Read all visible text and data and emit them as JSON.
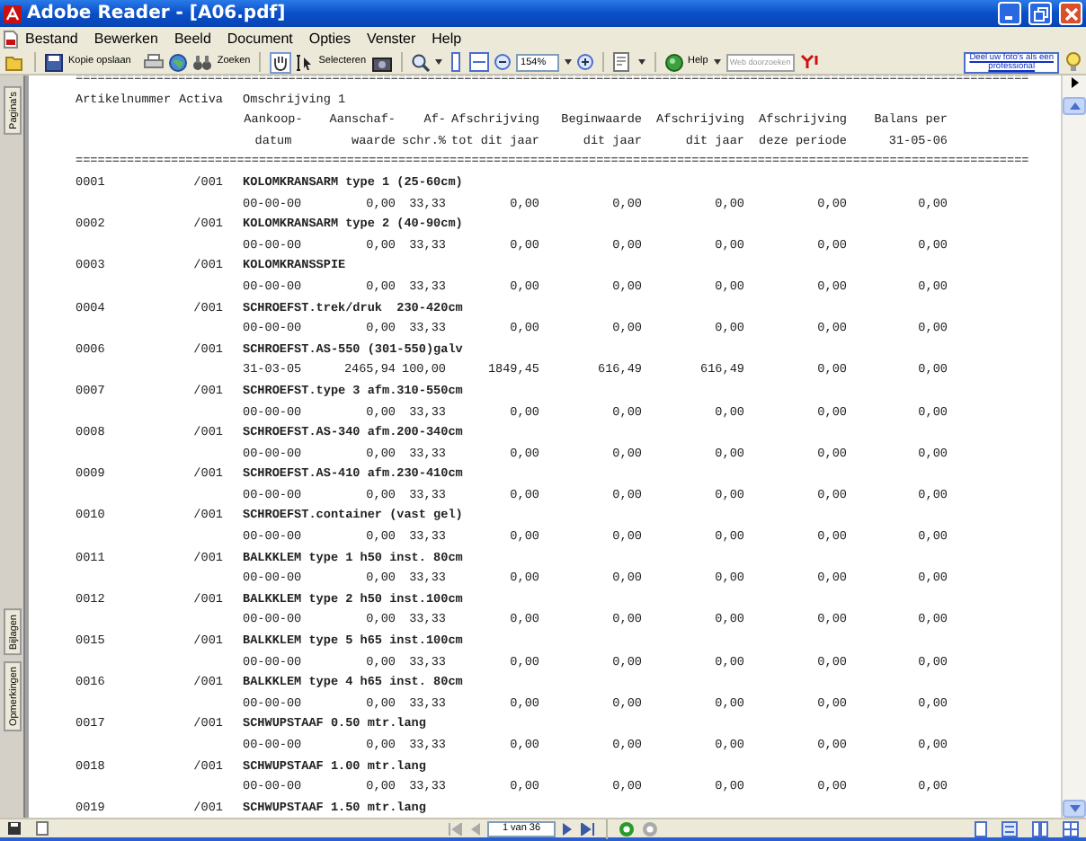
{
  "window": {
    "title": "Adobe Reader - [A06.pdf]"
  },
  "menu": [
    "Bestand",
    "Bewerken",
    "Beeld",
    "Document",
    "Opties",
    "Venster",
    "Help"
  ],
  "toolbar": {
    "save_label": "Kopie opslaan",
    "search_label": "Zoeken",
    "select_label": "Selecteren",
    "zoom": "154%",
    "help_label": "Help",
    "web_search": {
      "placeholder": "Web doorzoeken"
    },
    "ad": [
      "Deel uw foto's als een",
      "professional"
    ]
  },
  "side_tabs": [
    {
      "label": "Pagina's"
    },
    {
      "label": "Bijlagen"
    },
    {
      "label": "Opmerkingen"
    }
  ],
  "document": {
    "separator_top": "==================================================================================================================================",
    "header": {
      "code": "Artikelnummer",
      "activa": "Activa",
      "description": "Omschrijving 1",
      "columns": [
        [
          "Aankoop-",
          "datum"
        ],
        [
          "Aanschaf-",
          "waarde"
        ],
        [
          "Af-",
          "schr.%"
        ],
        [
          "Afschrijving",
          "tot dit jaar"
        ],
        [
          "Beginwaarde",
          "dit jaar"
        ],
        [
          "Afschrijving",
          "dit jaar"
        ],
        [
          "Afschrijving",
          "deze periode"
        ],
        [
          "Balans per",
          "31-05-06"
        ]
      ]
    },
    "separator_bottom": "==================================================================================================================================",
    "rows": [
      {
        "code": "0001",
        "activa": "/001",
        "description": "KOLOMKRANSARM type 1 (25-60cm)",
        "values": [
          "00-00-00",
          "0,00",
          "33,33",
          "0,00",
          "0,00",
          "0,00",
          "0,00",
          "0,00"
        ]
      },
      {
        "code": "0002",
        "activa": "/001",
        "description": "KOLOMKRANSARM type 2 (40-90cm)",
        "values": [
          "00-00-00",
          "0,00",
          "33,33",
          "0,00",
          "0,00",
          "0,00",
          "0,00",
          "0,00"
        ]
      },
      {
        "code": "0003",
        "activa": "/001",
        "description": "KOLOMKRANSSPIE",
        "values": [
          "00-00-00",
          "0,00",
          "33,33",
          "0,00",
          "0,00",
          "0,00",
          "0,00",
          "0,00"
        ]
      },
      {
        "code": "0004",
        "activa": "/001",
        "description": "SCHROEFST.trek/druk  230-420cm",
        "values": [
          "00-00-00",
          "0,00",
          "33,33",
          "0,00",
          "0,00",
          "0,00",
          "0,00",
          "0,00"
        ]
      },
      {
        "code": "0006",
        "activa": "/001",
        "description": "SCHROEFST.AS-550 (301-550)galv",
        "values": [
          "31-03-05",
          "2465,94",
          "100,00",
          "1849,45",
          "616,49",
          "616,49",
          "0,00",
          "0,00"
        ]
      },
      {
        "code": "0007",
        "activa": "/001",
        "description": "SCHROEFST.type 3 afm.310-550cm",
        "values": [
          "00-00-00",
          "0,00",
          "33,33",
          "0,00",
          "0,00",
          "0,00",
          "0,00",
          "0,00"
        ]
      },
      {
        "code": "0008",
        "activa": "/001",
        "description": "SCHROEFST.AS-340 afm.200-340cm",
        "values": [
          "00-00-00",
          "0,00",
          "33,33",
          "0,00",
          "0,00",
          "0,00",
          "0,00",
          "0,00"
        ]
      },
      {
        "code": "0009",
        "activa": "/001",
        "description": "SCHROEFST.AS-410 afm.230-410cm",
        "values": [
          "00-00-00",
          "0,00",
          "33,33",
          "0,00",
          "0,00",
          "0,00",
          "0,00",
          "0,00"
        ]
      },
      {
        "code": "0010",
        "activa": "/001",
        "description": "SCHROEFST.container (vast gel)",
        "values": [
          "00-00-00",
          "0,00",
          "33,33",
          "0,00",
          "0,00",
          "0,00",
          "0,00",
          "0,00"
        ]
      },
      {
        "code": "0011",
        "activa": "/001",
        "description": "BALKKLEM type 1 h50 inst. 80cm",
        "values": [
          "00-00-00",
          "0,00",
          "33,33",
          "0,00",
          "0,00",
          "0,00",
          "0,00",
          "0,00"
        ]
      },
      {
        "code": "0012",
        "activa": "/001",
        "description": "BALKKLEM type 2 h50 inst.100cm",
        "values": [
          "00-00-00",
          "0,00",
          "33,33",
          "0,00",
          "0,00",
          "0,00",
          "0,00",
          "0,00"
        ]
      },
      {
        "code": "0015",
        "activa": "/001",
        "description": "BALKKLEM type 5 h65 inst.100cm",
        "values": [
          "00-00-00",
          "0,00",
          "33,33",
          "0,00",
          "0,00",
          "0,00",
          "0,00",
          "0,00"
        ]
      },
      {
        "code": "0016",
        "activa": "/001",
        "description": "BALKKLEM type 4 h65 inst. 80cm",
        "values": [
          "00-00-00",
          "0,00",
          "33,33",
          "0,00",
          "0,00",
          "0,00",
          "0,00",
          "0,00"
        ]
      },
      {
        "code": "0017",
        "activa": "/001",
        "description": "SCHWUPSTAAF 0.50 mtr.lang",
        "values": [
          "00-00-00",
          "0,00",
          "33,33",
          "0,00",
          "0,00",
          "0,00",
          "0,00",
          "0,00"
        ]
      },
      {
        "code": "0018",
        "activa": "/001",
        "description": "SCHWUPSTAAF 1.00 mtr.lang",
        "values": [
          "00-00-00",
          "0,00",
          "33,33",
          "0,00",
          "0,00",
          "0,00",
          "0,00",
          "0,00"
        ]
      },
      {
        "code": "0019",
        "activa": "/001",
        "description": "SCHWUPSTAAF 1.50 mtr.lang"
      }
    ]
  },
  "status_bar": {
    "page": "1 van 36"
  }
}
